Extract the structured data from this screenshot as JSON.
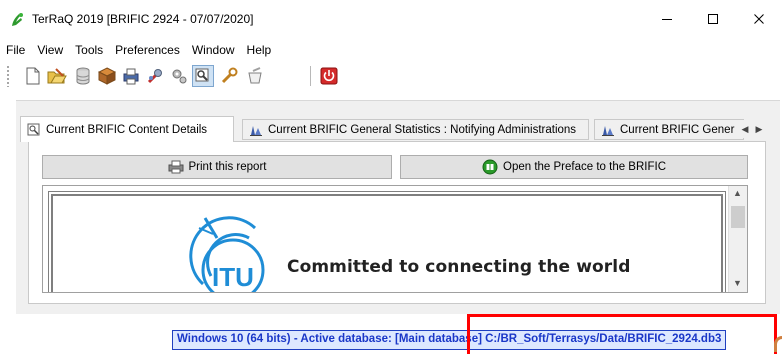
{
  "window": {
    "title": "TerRaQ 2019 [BRIFIC 2924 - 07/07/2020]",
    "controls": {
      "minimize": "minimize",
      "maximize": "maximize",
      "close": "close"
    }
  },
  "menu": {
    "items": [
      "File",
      "View",
      "Tools",
      "Preferences",
      "Window",
      "Help"
    ]
  },
  "toolbar": {
    "icons": [
      "new-document-icon",
      "open-folder-icon",
      "database-icon",
      "package-icon",
      "printer-icon",
      "tools-icon",
      "settings-icon",
      "search-database-icon",
      "wrench-icon",
      "clear-icon",
      "power-icon"
    ],
    "active": "search-database-icon"
  },
  "tabs": [
    {
      "label": "Current BRIFIC Content Details",
      "active": true
    },
    {
      "label": "Current BRIFIC General Statistics : Notifying Administrations",
      "active": false
    },
    {
      "label": "Current BRIFIC Gener",
      "active": false
    }
  ],
  "buttons": {
    "print": "Print this report",
    "preface": "Open the Preface to the BRIFIC"
  },
  "report": {
    "logo_text": "ITU",
    "slogan": "Committed to connecting the world"
  },
  "status": {
    "text": "Windows 10 (64 bits) - Active database: [Main database] C:/BR_Soft/Terrasys/Data/BRIFIC_2924.db3"
  },
  "colors": {
    "status_text": "#1a37c8",
    "highlight": "#ff0000",
    "itu_blue": "#1f8dd6"
  }
}
